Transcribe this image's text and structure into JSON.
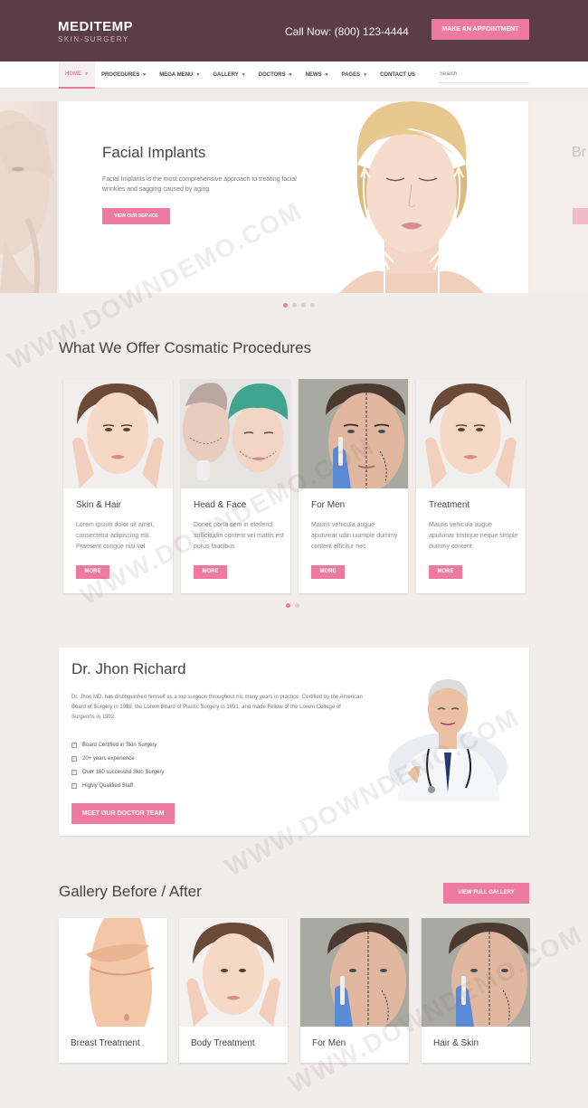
{
  "header": {
    "logo_title": "MEDITEMP",
    "logo_subtitle": "SKIN-SURGERY",
    "call_now": "Call Now: (800) 123-4444",
    "appointment_label": "MAKE AN APPOINTMENT"
  },
  "nav": {
    "items": [
      {
        "label": "HOME",
        "caret": "▼",
        "active": true
      },
      {
        "label": "PROCEDURES",
        "caret": "▼"
      },
      {
        "label": "MEGA MENU",
        "caret": "▼"
      },
      {
        "label": "GALLERY",
        "caret": "▼"
      },
      {
        "label": "DOCTORS",
        "caret": "▼"
      },
      {
        "label": "NEWS",
        "caret": "▼"
      },
      {
        "label": "PAGES",
        "caret": "▼"
      },
      {
        "label": "CONTACT US"
      }
    ],
    "search_placeholder": "Search"
  },
  "hero": {
    "title": "Facial Implants",
    "description": "Facial Implants is the most comprehensive approach to treating facial wrinkles and sagging caused by aging",
    "button_label": "VIEW OUR SERVICE",
    "next_slide_partial": "Br",
    "slides": 4,
    "active_slide": 1
  },
  "procedures": {
    "title": "What We Offer Cosmatic Procedures",
    "cards": [
      {
        "name": "Skin & Hair",
        "description": "Lorem ipsum dolor sit amet, consectetur adipiscing elit. Praesent congue nisi vel",
        "button": "MORE",
        "image": "woman-face"
      },
      {
        "name": "Head & Face",
        "description": "Donec porta sem in eleifend sollicitudin content vel mattis est purus faucibus",
        "button": "MORE",
        "image": "surgery-patients"
      },
      {
        "name": "For Men",
        "description": "Mauris vehicula augue aputvinar udin uuimple dummy content efficitur nec",
        "button": "MORE",
        "image": "man-face-markings"
      },
      {
        "name": "Treatment",
        "description": "Mauris vehicula augue apulvinar tristique neque simple dummy content",
        "button": "MORE",
        "image": "woman-face"
      }
    ],
    "pages": 2,
    "active_page": 1
  },
  "doctor": {
    "name": "Dr. Jhon Richard",
    "bio": "Dr. Jhon MD, has distinguished himself as a top surgeon throughout his many years in practice. Certified by the American Board of Surgery in 1989, the Lorem Board of Plastic Surgery in 1991, and made Fellow of the Lorem College of Surgeons in 1992.",
    "credentials": [
      "Board Certified in Skin Surgery",
      "20+ years experience",
      "Over 160 successful Skin Surgery",
      "Highly Qualified Staff"
    ],
    "button_label": "MEET OUR DOCTOR TEAM"
  },
  "gallery": {
    "title": "Gallery Before / After",
    "button_label": "VIEW FULL GALLERY",
    "items": [
      {
        "caption": "Breast Treatment",
        "image": "torso"
      },
      {
        "caption": "Body Treatment",
        "image": "woman-face"
      },
      {
        "caption": "For Men",
        "image": "man-face-markings"
      },
      {
        "caption": "Hair & Skin",
        "image": "man-face-markings"
      }
    ]
  },
  "watermark": "WWW.DOWNDEMO.COM",
  "colors": {
    "header_bg": "#5b3d48",
    "accent": "#ef7aa1",
    "page_bg": "#f1edea"
  }
}
